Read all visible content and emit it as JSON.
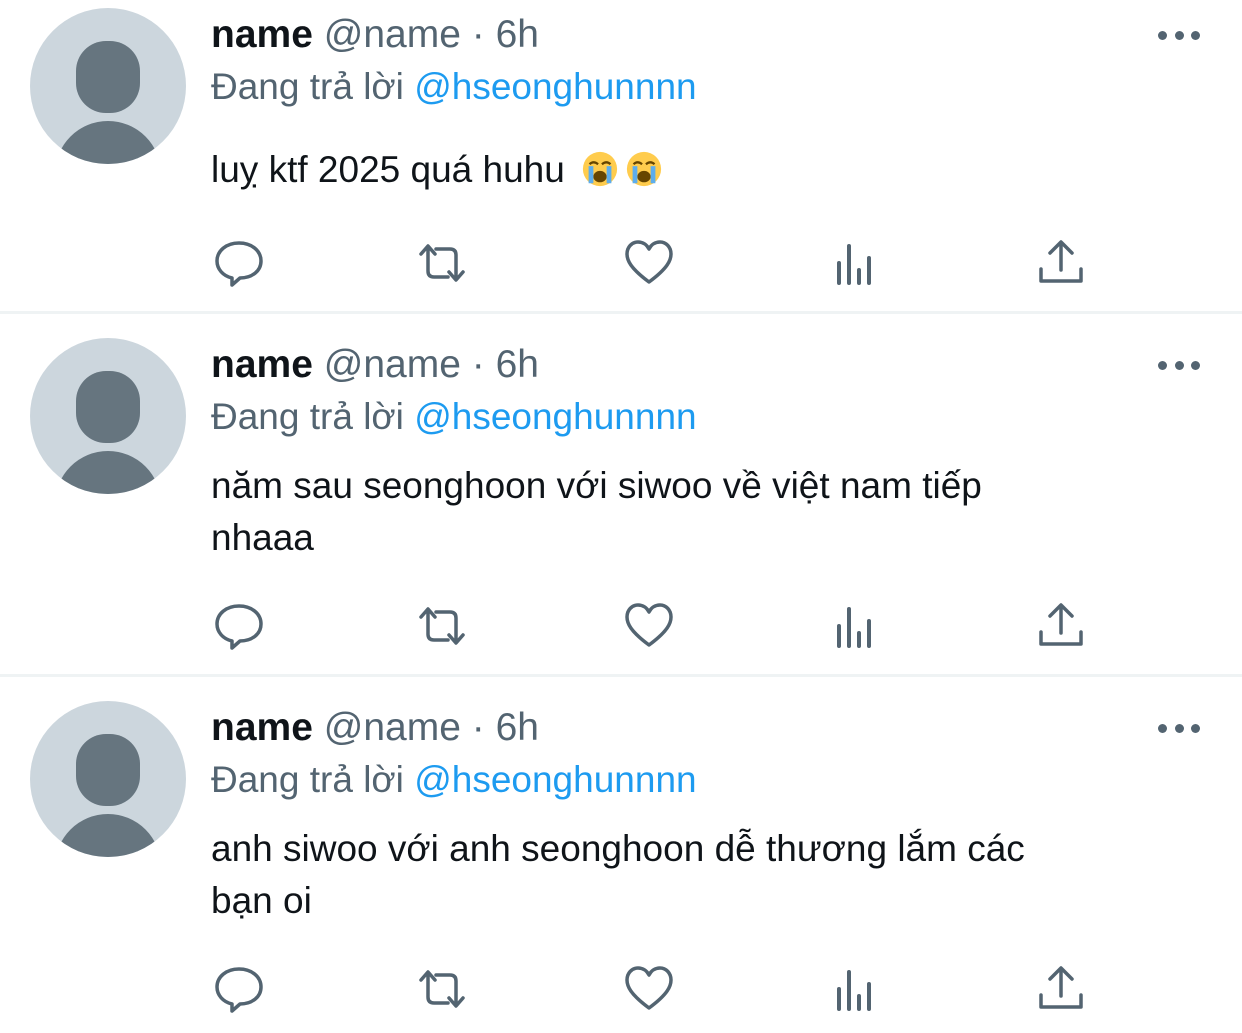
{
  "tweets": [
    {
      "display_name": "name",
      "handle": "@name",
      "separator": "·",
      "time": "6h",
      "reply_prefix": "Đang trả lời",
      "reply_to": "@hseonghunnnn",
      "text": "luỵ ktf 2025 quá huhu",
      "emojis": [
        "loudly-crying-face",
        "loudly-crying-face"
      ]
    },
    {
      "display_name": "name",
      "handle": "@name",
      "separator": "·",
      "time": "6h",
      "reply_prefix": "Đang trả lời",
      "reply_to": "@hseonghunnnn",
      "text_lines": [
        "năm sau seonghoon với siwoo về việt nam tiếp",
        "nhaaa"
      ]
    },
    {
      "display_name": "name",
      "handle": "@name",
      "separator": "·",
      "time": "6h",
      "reply_prefix": "Đang trả lời",
      "reply_to": "@hseonghunnnn",
      "text_lines": [
        "anh siwoo với anh seonghoon dễ thương lắm các",
        "bạn oi"
      ]
    }
  ],
  "action_icons": [
    "reply-icon",
    "retweet-icon",
    "like-icon",
    "views-icon",
    "share-icon"
  ],
  "colors": {
    "text": "#0f1419",
    "secondary": "#536471",
    "link": "#1d9bf0",
    "divider": "#eff3f4",
    "avatar_bg": "#ccd6dd",
    "avatar_fg": "#66757f"
  }
}
